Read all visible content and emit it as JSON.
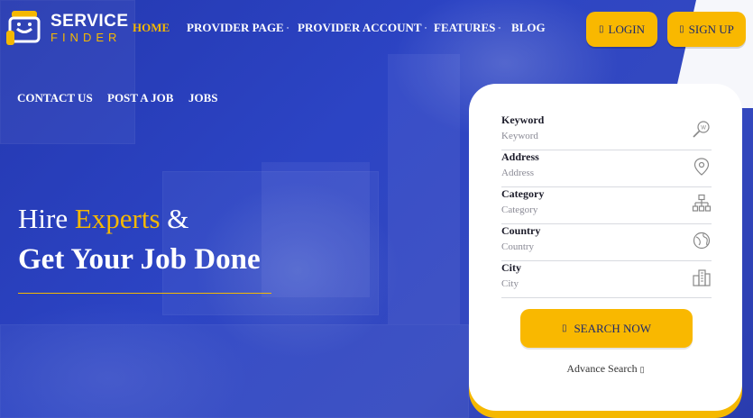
{
  "brand": {
    "name_line1": "SERVICE",
    "name_line2": "FINDER"
  },
  "nav": {
    "home": "HOME",
    "provider_page": "PROVIDER PAGE",
    "provider_account": "PROVIDER ACCOUNT",
    "features": "FEATURES",
    "blog": "BLOG",
    "contact_us": "CONTACT US",
    "post_a_job": "POST A JOB",
    "jobs": "JOBS",
    "dropdown_glyph": "▫"
  },
  "auth": {
    "login": "LOGIN",
    "sign_up": "SIGN UP",
    "icon_glyph": "▯"
  },
  "hero": {
    "line1_prefix": "Hire ",
    "line1_accent": "Experts",
    "line1_suffix": " &",
    "line2": "Get Your Job Done"
  },
  "search_form": {
    "fields": [
      {
        "label": "Keyword",
        "placeholder": "Keyword",
        "value": "",
        "icon": "search-web-icon"
      },
      {
        "label": "Address",
        "placeholder": "Address",
        "value": "",
        "icon": "location-pin-icon"
      },
      {
        "label": "Category",
        "placeholder": "Category",
        "value": "",
        "icon": "sitemap-icon"
      },
      {
        "label": "Country",
        "placeholder": "Country",
        "value": "",
        "icon": "globe-icon"
      },
      {
        "label": "City",
        "placeholder": "City",
        "value": "",
        "icon": "buildings-icon"
      }
    ],
    "search_button": "SEARCH NOW",
    "search_button_glyph": "▯",
    "advance_search": "Advance Search",
    "advance_glyph": "▯"
  },
  "colors": {
    "accent": "#f9b800",
    "primary_blue": "#2a3fb8",
    "button_text": "#1d2a6e"
  }
}
